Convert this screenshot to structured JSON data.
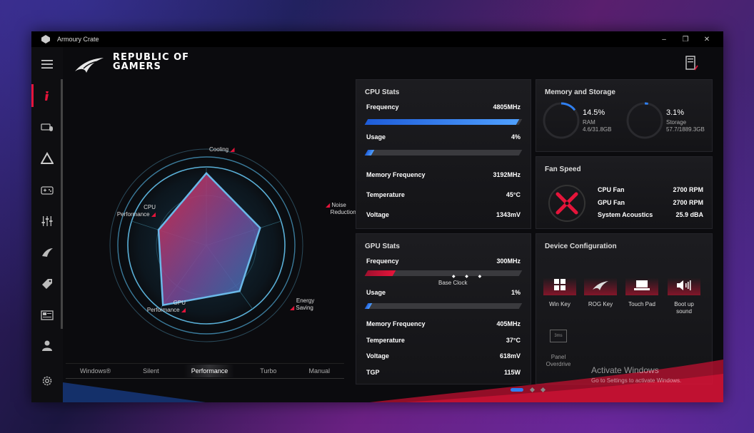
{
  "window": {
    "title": "Armoury Crate",
    "controls": [
      "–",
      "❐",
      "✕"
    ]
  },
  "brand": {
    "line1": "REPUBLIC OF",
    "line2": "GAMERS"
  },
  "radar": {
    "labels": {
      "cooling": "Cooling",
      "noise": [
        "Noise",
        "Reduction"
      ],
      "energy": [
        "Energy",
        "Saving"
      ],
      "gpu": [
        "GPU",
        "Performance"
      ],
      "cpu": [
        "CPU",
        "Performance"
      ]
    },
    "levels": {
      "cooling": 0.92,
      "noise": 0.72,
      "energy": 0.72,
      "gpu": 0.94,
      "cpu": 0.64
    }
  },
  "modes": {
    "items": [
      "Windows®",
      "Silent",
      "Performance",
      "Turbo",
      "Manual"
    ],
    "selected": "Performance"
  },
  "cpu_stats": {
    "title": "CPU Stats",
    "frequency_label": "Frequency",
    "frequency_value": "4805MHz",
    "frequency_fill": 0.98,
    "usage_label": "Usage",
    "usage_value": "4%",
    "usage_fill": 0.04,
    "mem_freq_label": "Memory Frequency",
    "mem_freq_value": "3192MHz",
    "temp_label": "Temperature",
    "temp_value": "45°C",
    "voltage_label": "Voltage",
    "voltage_value": "1343mV"
  },
  "gpu_stats": {
    "title": "GPU Stats",
    "frequency_label": "Frequency",
    "frequency_value": "300MHz",
    "frequency_fill": 0.18,
    "base_clock_label": "Base Clock",
    "usage_label": "Usage",
    "usage_value": "1%",
    "usage_fill": 0.01,
    "mem_freq_label": "Memory Frequency",
    "mem_freq_value": "405MHz",
    "temp_label": "Temperature",
    "temp_value": "37°C",
    "voltage_label": "Voltage",
    "voltage_value": "618mV",
    "tgp_label": "TGP",
    "tgp_value": "115W"
  },
  "memory": {
    "title": "Memory and Storage",
    "ram_percent": "14.5%",
    "ram_label": "RAM",
    "ram_detail": "4.6/31.8GB",
    "ram_fill": 0.145,
    "storage_percent": "3.1%",
    "storage_label": "Storage",
    "storage_detail": "57.7/1889.3GB",
    "storage_fill": 0.031
  },
  "fan": {
    "title": "Fan Speed",
    "cpu_label": "CPU Fan",
    "cpu_value": "2700 RPM",
    "gpu_label": "GPU Fan",
    "gpu_value": "2700 RPM",
    "acoustics_label": "System Acoustics",
    "acoustics_value": "25.9 dBA"
  },
  "device": {
    "title": "Device Configuration",
    "win_key": "Win Key",
    "rog_key": "ROG Key",
    "touch_pad": "Touch Pad",
    "boot_sound": [
      "Boot up",
      "sound"
    ],
    "panel_overdrive": [
      "Panel",
      "Overdrive"
    ],
    "panel_icon_text": "3ms"
  },
  "activation": {
    "line1": "Activate Windows",
    "line2": "Go to Settings to activate Windows."
  },
  "colors": {
    "accent_red": "#e5143a",
    "accent_blue": "#2f7ff0",
    "bg": "#0b0b0e"
  }
}
